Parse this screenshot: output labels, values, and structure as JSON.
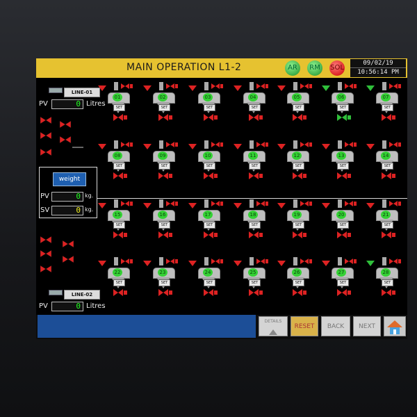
{
  "header": {
    "title": "MAIN OPERATION L1-2",
    "indicators": [
      {
        "label": "AR",
        "color": "#2fbf3a"
      },
      {
        "label": "RM",
        "color": "#2fbf3a"
      },
      {
        "label": "SOL",
        "color": "#dd2222"
      }
    ],
    "date": "09/02/19",
    "time": "10:56:14 PM"
  },
  "line1": {
    "tag": "LINE-01",
    "pv_label": "PV",
    "pv_value": "0",
    "unit": "Litres"
  },
  "line2": {
    "tag": "LINE-02",
    "pv_label": "PV",
    "pv_value": "0",
    "unit": "Litres"
  },
  "weight": {
    "button_label": "weight",
    "pv_label": "PV",
    "pv_value": "0",
    "sv_label": "SV",
    "sv_value": "0",
    "unit": "kg."
  },
  "silos": {
    "numbers": [
      "01",
      "02",
      "03",
      "04",
      "05",
      "06",
      "07",
      "08",
      "09",
      "10",
      "11",
      "12",
      "13",
      "14",
      "15",
      "16",
      "17",
      "18",
      "19",
      "20",
      "21",
      "22",
      "23",
      "24",
      "25",
      "26",
      "27",
      "28"
    ],
    "set_label": "SET",
    "valve_active": [
      6,
      7,
      28
    ]
  },
  "navigation": {
    "details": "DETAILS",
    "reset": "RESET",
    "back": "BACK",
    "next": "NEXT",
    "home_icon": "home-icon"
  },
  "colors": {
    "title_bar": "#e6c230",
    "silo_number": "#34d134",
    "status_bar": "#1c4e97",
    "valve_red": "#dd2222",
    "valve_green": "#2fbf3a"
  }
}
